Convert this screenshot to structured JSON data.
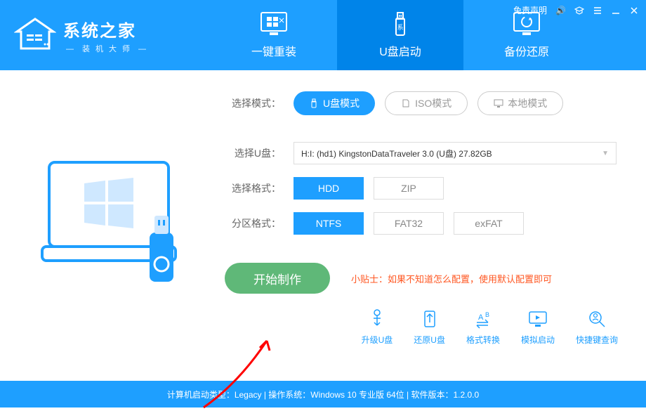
{
  "header": {
    "logo_title": "系统之家",
    "logo_sub": "装机大师",
    "disclaimer": "免责声明"
  },
  "tabs": [
    {
      "label": "一键重装"
    },
    {
      "label": "U盘启动"
    },
    {
      "label": "备份还原"
    }
  ],
  "mode": {
    "label": "选择模式：",
    "usb": "U盘模式",
    "iso": "ISO模式",
    "local": "本地模式"
  },
  "drive": {
    "label": "选择U盘：",
    "value": "H:I: (hd1) KingstonDataTraveler 3.0 (U盘) 27.82GB"
  },
  "format": {
    "label": "选择格式：",
    "hdd": "HDD",
    "zip": "ZIP"
  },
  "partition": {
    "label": "分区格式：",
    "ntfs": "NTFS",
    "fat32": "FAT32",
    "exfat": "exFAT"
  },
  "start_label": "开始制作",
  "tip": "小贴士：如果不知道怎么配置，使用默认配置即可",
  "tools": {
    "upgrade": "升级U盘",
    "restore": "还原U盘",
    "convert": "格式转换",
    "simulate": "模拟启动",
    "shortcut": "快捷键查询"
  },
  "footer": "计算机启动类型：Legacy | 操作系统：Windows 10 专业版 64位 | 软件版本：1.2.0.0"
}
